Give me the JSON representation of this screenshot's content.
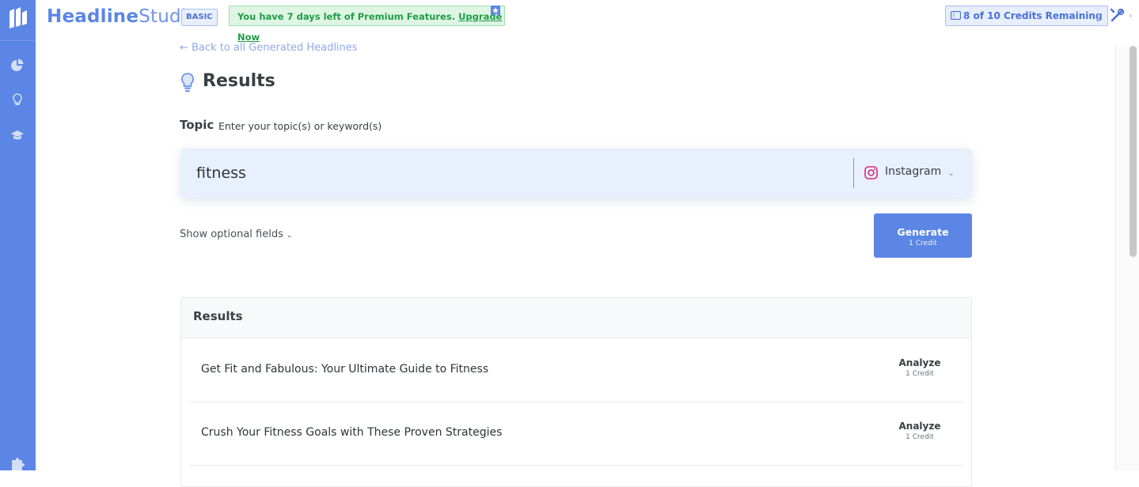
{
  "app": {
    "brand_part1": "Headline",
    "brand_part2": "Studio",
    "plan": "BASIC",
    "promo_text": "You have 7 days left of Premium Features.",
    "promo_link": "Upgrade Now",
    "credits": "8 of 10 Credits Remaining"
  },
  "sidebar": {
    "icons": [
      "logo-icon",
      "pie-chart-icon",
      "lightbulb-icon",
      "graduation-cap-icon",
      "puzzle-icon"
    ]
  },
  "page": {
    "back_link": "← Back to all Generated Headlines",
    "title": "Results",
    "topic_label": "Topic",
    "topic_hint": "Enter your topic(s) or keyword(s)",
    "topic_value": "fitness",
    "platform": "Instagram",
    "optional_fields": "Show optional fields",
    "generate_label": "Generate",
    "generate_cost": "1 Credit"
  },
  "results": {
    "header": "Results",
    "rows": [
      {
        "headline": "Get Fit and Fabulous: Your Ultimate Guide to Fitness",
        "action": "Analyze",
        "cost": "1 Credit"
      },
      {
        "headline": "Crush Your Fitness Goals with These Proven Strategies",
        "action": "Analyze",
        "cost": "1 Credit"
      }
    ]
  },
  "colors": {
    "primary": "#5b86e5",
    "promo_bg": "#dff5e4",
    "promo_text": "#1f9d46",
    "input_bg": "#e8f0fd"
  }
}
